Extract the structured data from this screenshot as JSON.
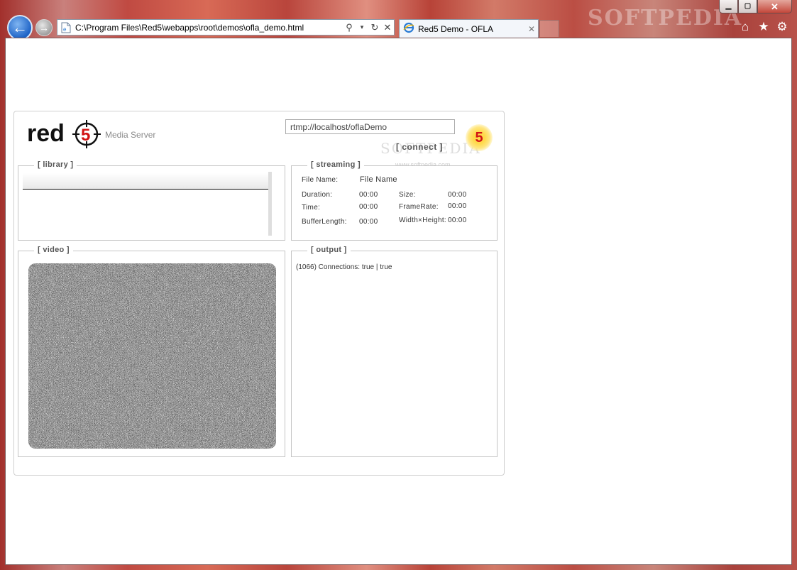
{
  "window": {
    "watermark": "SOFTPEDIA",
    "controls": {
      "minimize_icon": "minimize-icon",
      "maximize_icon": "maximize-icon",
      "close_icon": "close-icon"
    }
  },
  "address_bar": {
    "url": "C:\\Program Files\\Red5\\webapps\\root\\demos\\ofla_demo.html"
  },
  "tab": {
    "title": "Red5 Demo - OFLA"
  },
  "app": {
    "logo_text": "red",
    "logo_number": "5",
    "subtitle": "Media Server",
    "rtmp_url": "rtmp://localhost/oflaDemo",
    "connect_label": "[ connect ]",
    "badge": "5",
    "watermark": "SOFTPEDIA",
    "watermark_small": "www.softpedia.com",
    "library": {
      "title": "[ library ]"
    },
    "streaming": {
      "title": "[ streaming ]",
      "file_name_label": "File Name:",
      "file_name_value": "File Name",
      "duration_label": "Duration:",
      "duration_value": "00:00",
      "size_label": "Size:",
      "size_value": "00:00",
      "time_label": "Time:",
      "time_value": "00:00",
      "framerate_label": "FrameRate:",
      "framerate_value": "00:00",
      "bufferlength_label": "BufferLength:",
      "bufferlength_value": "00:00",
      "widthheight_label": "Width×Height:",
      "widthheight_value": "00:00"
    },
    "video": {
      "title": "[ video ]"
    },
    "output": {
      "title": "[ output ]",
      "log": "(1066) Connections: true | true"
    }
  },
  "colors": {
    "accent_red": "#d21414",
    "nav_blue": "#1e63c6",
    "badge_yellow": "#ffd94a"
  }
}
